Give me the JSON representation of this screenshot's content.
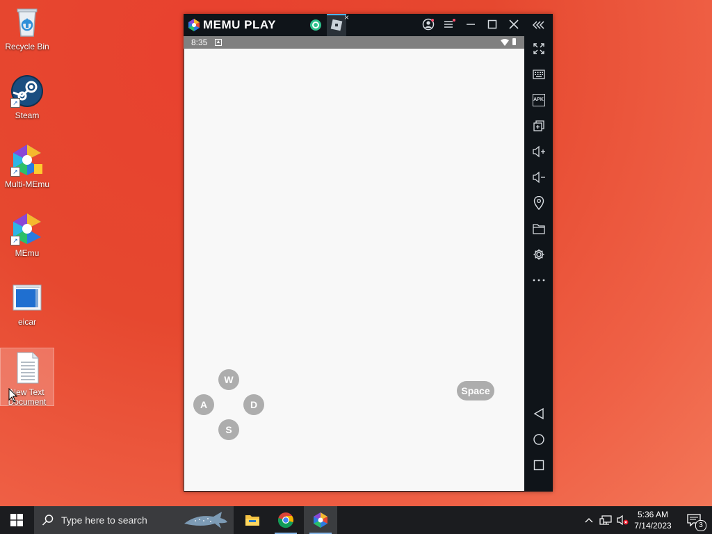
{
  "desktop": {
    "icons": [
      {
        "label": "Recycle Bin"
      },
      {
        "label": "Steam"
      },
      {
        "label": "Multi-MEmu"
      },
      {
        "label": "MEmu"
      },
      {
        "label": "eicar"
      },
      {
        "label": "New Text Document"
      }
    ]
  },
  "emulator": {
    "brand": "MEMU PLAY",
    "tab_close": "×",
    "status_time": "8:35",
    "sidebar_icons": [
      "fullscreen-icon",
      "keyboard-icon",
      "apk-icon",
      "multi-window-icon",
      "volume-up-icon",
      "volume-down-icon",
      "location-icon",
      "folder-icon",
      "settings-icon",
      "more-icon",
      "back-icon",
      "home-icon",
      "recents-icon"
    ],
    "apk_text": "APK",
    "keys": {
      "w": "W",
      "a": "A",
      "s": "S",
      "d": "D",
      "space": "Space"
    }
  },
  "taskbar": {
    "search_placeholder": "Type here to search",
    "clock_time": "5:36 AM",
    "clock_date": "7/14/2023",
    "notification_count": "3"
  },
  "colors": {
    "desktop_bg": "#e6482f",
    "title_bar": "#0f1419",
    "status_bar": "#808080",
    "key_overlay": "#adadad",
    "taskbar": "#1b1c1f"
  }
}
